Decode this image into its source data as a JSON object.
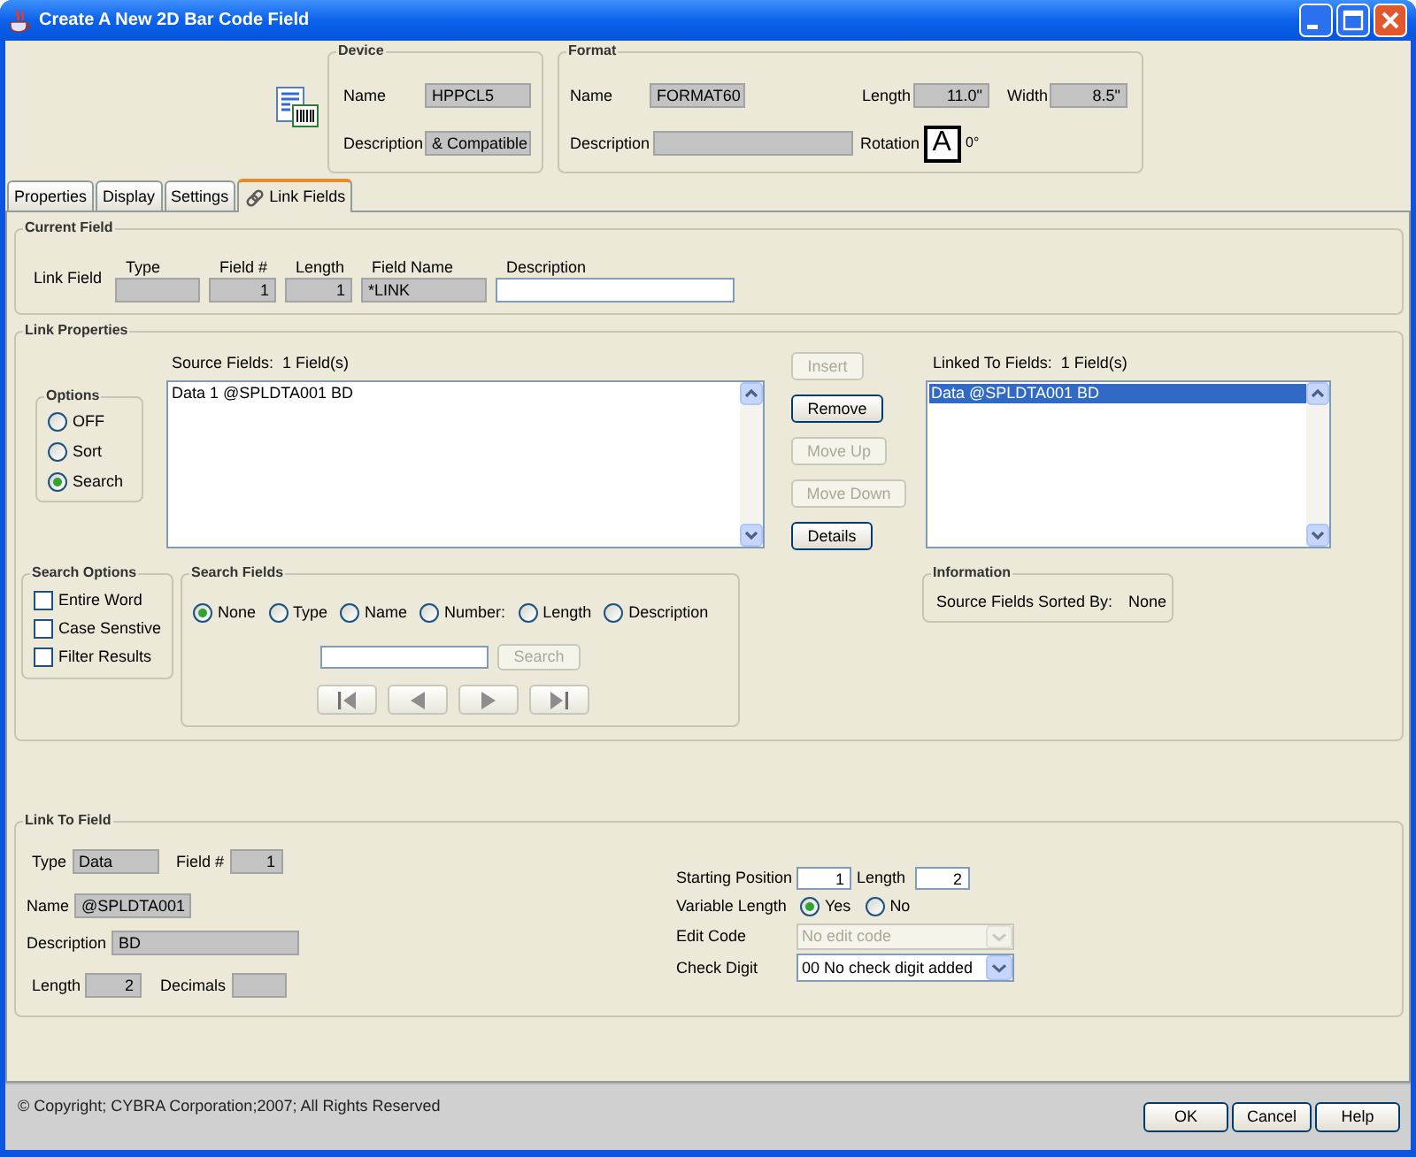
{
  "window": {
    "title": "Create A New 2D Bar Code Field"
  },
  "device": {
    "legend": "Device",
    "fields": [
      {
        "label": "Name",
        "value": "HPPCL5",
        "kind": "readonly"
      },
      {
        "label": "Description",
        "value": "& Compatible",
        "kind": "readonly"
      }
    ]
  },
  "format": {
    "legend": "Format",
    "fields": [
      {
        "label": "Name",
        "value": "FORMAT60",
        "kind": "readonly"
      },
      {
        "label": "Length",
        "value": "11.0\"",
        "kind": "readonly"
      },
      {
        "label": "Width",
        "value": "8.5\"",
        "kind": "readonly"
      },
      {
        "label": "Description",
        "kind": "readonly"
      }
    ],
    "rotation": {
      "label": "Rotation",
      "preview": "A",
      "value": "0°"
    }
  },
  "tabs": [
    {
      "label": "Properties",
      "selected": false
    },
    {
      "label": "Display",
      "selected": false
    },
    {
      "label": "Settings",
      "selected": false
    },
    {
      "label": "Link Fields",
      "selected": true
    }
  ],
  "current_field": {
    "legend": "Current Field",
    "label": "Link Field",
    "columns": [
      {
        "header": "Type",
        "kind": "readonly"
      },
      {
        "header": "Field #",
        "value": "1",
        "kind": "readonly"
      },
      {
        "header": "Length",
        "value": "1",
        "kind": "readonly"
      },
      {
        "header": "Field Name",
        "value": "*LINK",
        "kind": "readonly"
      },
      {
        "header": "Description",
        "kind": "input"
      }
    ]
  },
  "link_properties": {
    "legend": "Link Properties",
    "options": {
      "legend": "Options",
      "items": [
        {
          "label": "OFF",
          "selected": false
        },
        {
          "label": "Sort",
          "selected": false
        },
        {
          "label": "Search",
          "selected": true
        }
      ]
    },
    "source_fields": {
      "label": "Source Fields:",
      "count": "1 Field(s)",
      "items": [
        {
          "text": "Data 1 @SPLDTA001 BD",
          "selected": false
        }
      ]
    },
    "buttons": [
      {
        "label": "Insert",
        "disabled": true
      },
      {
        "label": "Remove",
        "disabled": false
      },
      {
        "label": "Move Up",
        "disabled": true
      },
      {
        "label": "Move Down",
        "disabled": true
      },
      {
        "label": "Details",
        "disabled": false
      }
    ],
    "linked_fields": {
      "label": "Linked To Fields:",
      "count": "1 Field(s)",
      "items": [
        {
          "text": "Data @SPLDTA001 BD",
          "selected": true
        }
      ]
    },
    "search_options": {
      "legend": "Search Options",
      "items": [
        {
          "label": "Entire Word",
          "checked": false
        },
        {
          "label": "Case Senstive",
          "checked": false
        },
        {
          "label": "Filter Results",
          "checked": false
        }
      ]
    },
    "search_fields": {
      "legend": "Search Fields",
      "items": [
        {
          "label": "None",
          "selected": true
        },
        {
          "label": "Type",
          "selected": false
        },
        {
          "label": "Name",
          "selected": false
        },
        {
          "label": "Number:",
          "selected": false
        },
        {
          "label": "Length",
          "selected": false
        },
        {
          "label": "Description",
          "selected": false
        }
      ],
      "search_button": {
        "label": "Search",
        "disabled": true
      }
    },
    "information": {
      "legend": "Information",
      "label": "Source Fields Sorted By:",
      "value": "None"
    }
  },
  "link_to_field": {
    "legend": "Link To Field",
    "fields": [
      {
        "label": "Type",
        "value": "Data",
        "kind": "readonly"
      },
      {
        "label": "Field #",
        "value": "1",
        "kind": "readonly"
      },
      {
        "label": "Name",
        "value": "@SPLDTA001",
        "kind": "readonly"
      },
      {
        "label": "Description",
        "value": "BD",
        "kind": "readonly"
      },
      {
        "label": "Length",
        "value": "2",
        "kind": "readonly"
      },
      {
        "label": "Decimals",
        "kind": "readonly"
      }
    ],
    "starting_position": {
      "label": "Starting Position",
      "value": "1",
      "kind": "input"
    },
    "length": {
      "label": "Length",
      "value": "2",
      "kind": "input"
    },
    "variable_length": {
      "label": "Variable Length",
      "options": [
        {
          "label": "Yes",
          "selected": true
        },
        {
          "label": "No",
          "selected": false
        }
      ]
    },
    "edit_code": {
      "label": "Edit Code",
      "value": "No edit code",
      "disabled": true
    },
    "check_digit": {
      "label": "Check Digit",
      "value": "00 No check digit added",
      "disabled": false
    }
  },
  "footer": {
    "copyright": "© Copyright; CYBRA Corporation;2007; All Rights Reserved",
    "buttons": [
      {
        "label": "OK"
      },
      {
        "label": "Cancel"
      },
      {
        "label": "Help"
      }
    ]
  }
}
